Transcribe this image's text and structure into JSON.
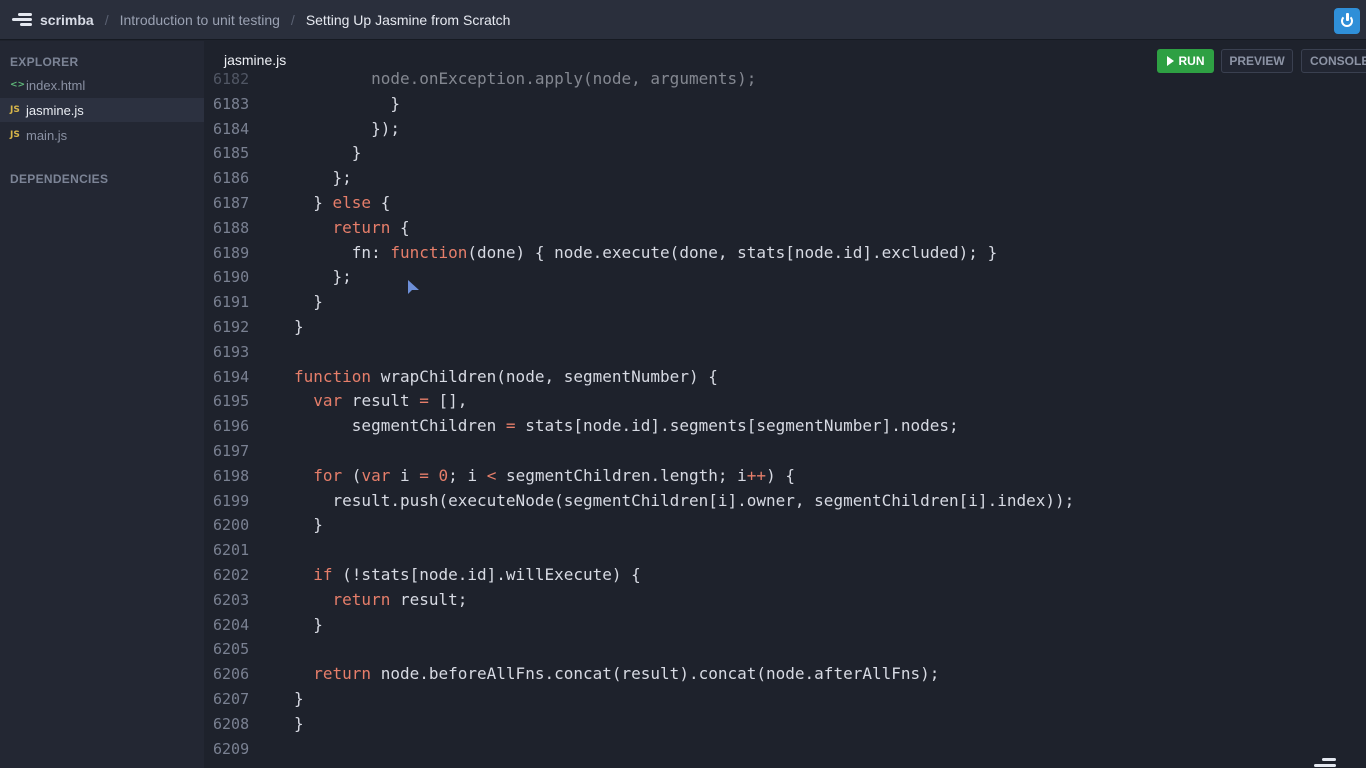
{
  "topbar": {
    "app_name": "scrimba",
    "breadcrumbs": [
      "Introduction to unit testing",
      "Setting Up Jasmine from Scratch"
    ]
  },
  "sidebar": {
    "explorer_heading": "EXPLORER",
    "files": [
      {
        "icon": "<>",
        "name": "index.html",
        "type": "html",
        "active": false
      },
      {
        "icon": "JS",
        "name": "jasmine.js",
        "type": "js",
        "active": true
      },
      {
        "icon": "JS",
        "name": "main.js",
        "type": "js",
        "active": false
      }
    ],
    "dependencies_heading": "DEPENDENCIES"
  },
  "editor": {
    "tab_title": "jasmine.js",
    "run_label": "RUN",
    "preview_label": "PREVIEW",
    "console_label": "CONSOLE",
    "lines": [
      {
        "n": "6182",
        "code": "        node.onException.apply(node, arguments);"
      },
      {
        "n": "6183",
        "code": "          }"
      },
      {
        "n": "6184",
        "code": "        });"
      },
      {
        "n": "6185",
        "code": "      }"
      },
      {
        "n": "6186",
        "code": "    };"
      },
      {
        "n": "6187",
        "code": "  } else {"
      },
      {
        "n": "6188",
        "code": "    return {"
      },
      {
        "n": "6189",
        "code": "      fn: function(done) { node.execute(done, stats[node.id].excluded); }"
      },
      {
        "n": "6190",
        "code": "    };"
      },
      {
        "n": "6191",
        "code": "  }"
      },
      {
        "n": "6192",
        "code": "}"
      },
      {
        "n": "6193",
        "code": ""
      },
      {
        "n": "6194",
        "code": "function wrapChildren(node, segmentNumber) {"
      },
      {
        "n": "6195",
        "code": "  var result = [],"
      },
      {
        "n": "6196",
        "code": "      segmentChildren = stats[node.id].segments[segmentNumber].nodes;"
      },
      {
        "n": "6197",
        "code": ""
      },
      {
        "n": "6198",
        "code": "  for (var i = 0; i < segmentChildren.length; i++) {"
      },
      {
        "n": "6199",
        "code": "    result.push(executeNode(segmentChildren[i].owner, segmentChildren[i].index));"
      },
      {
        "n": "6200",
        "code": "  }"
      },
      {
        "n": "6201",
        "code": ""
      },
      {
        "n": "6202",
        "code": "  if (!stats[node.id].willExecute) {"
      },
      {
        "n": "6203",
        "code": "    return result;"
      },
      {
        "n": "6204",
        "code": "  }"
      },
      {
        "n": "6205",
        "code": ""
      },
      {
        "n": "6206",
        "code": "  return node.beforeAllFns.concat(result).concat(node.afterAllFns);"
      },
      {
        "n": "6207",
        "code": "}"
      },
      {
        "n": "6208",
        "code": "}"
      },
      {
        "n": "6209",
        "code": ""
      }
    ]
  },
  "colors": {
    "keyword": "#e67e6a",
    "run_button": "#2ea043",
    "power_button": "#2f8fd8"
  }
}
